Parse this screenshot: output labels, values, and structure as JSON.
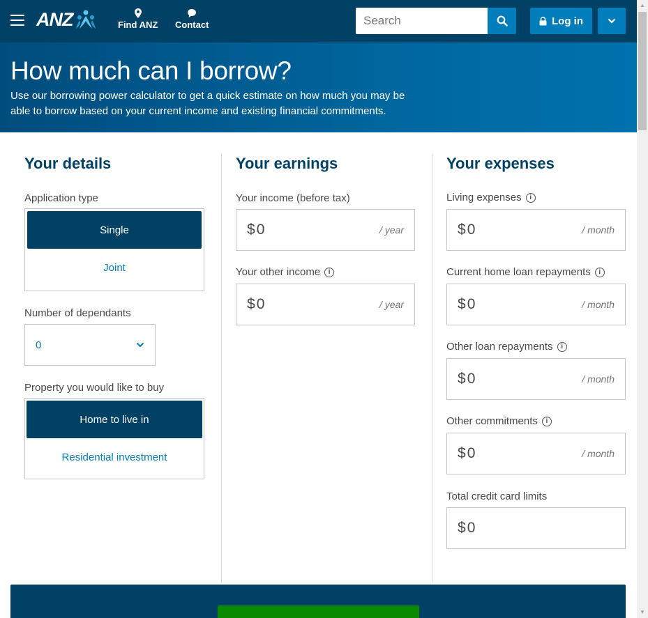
{
  "header": {
    "brand": "ANZ",
    "nav": [
      {
        "label": "Find ANZ",
        "icon": "location-pin-icon"
      },
      {
        "label": "Contact",
        "icon": "speech-bubble-icon"
      }
    ],
    "search_placeholder": "Search",
    "login_label": "Log in"
  },
  "hero": {
    "title": "How much can I borrow?",
    "description": "Use our borrowing power calculator to get a quick estimate on how much you may be able to borrow based on your current income and existing financial commitments."
  },
  "details": {
    "heading": "Your details",
    "application_type_label": "Application type",
    "application_types": [
      "Single",
      "Joint"
    ],
    "selected_application_type": "Single",
    "dependants_label": "Number of dependants",
    "dependants_value": "0",
    "property_label": "Property you would like to buy",
    "property_options": [
      "Home to live in",
      "Residential investment"
    ],
    "selected_property": "Home to live in"
  },
  "earnings": {
    "heading": "Your earnings",
    "fields": [
      {
        "label": "Your income (before tax)",
        "currency": "$",
        "value": "0",
        "period": "/ year",
        "info": false
      },
      {
        "label": "Your other income",
        "currency": "$",
        "value": "0",
        "period": "/ year",
        "info": true
      }
    ]
  },
  "expenses": {
    "heading": "Your expenses",
    "fields": [
      {
        "label": "Living expenses",
        "currency": "$",
        "value": "0",
        "period": "/ month",
        "info": true
      },
      {
        "label": "Current home loan repayments",
        "currency": "$",
        "value": "0",
        "period": "/ month",
        "info": true
      },
      {
        "label": "Other loan repayments",
        "currency": "$",
        "value": "0",
        "period": "/ month",
        "info": true
      },
      {
        "label": "Other commitments",
        "currency": "$",
        "value": "0",
        "period": "/ month",
        "info": true
      },
      {
        "label": "Total credit card limits",
        "currency": "$",
        "value": "0",
        "period": "",
        "info": false
      }
    ]
  },
  "colors": {
    "navy": "#004165",
    "blue": "#007dba",
    "green": "#0b8a00"
  }
}
